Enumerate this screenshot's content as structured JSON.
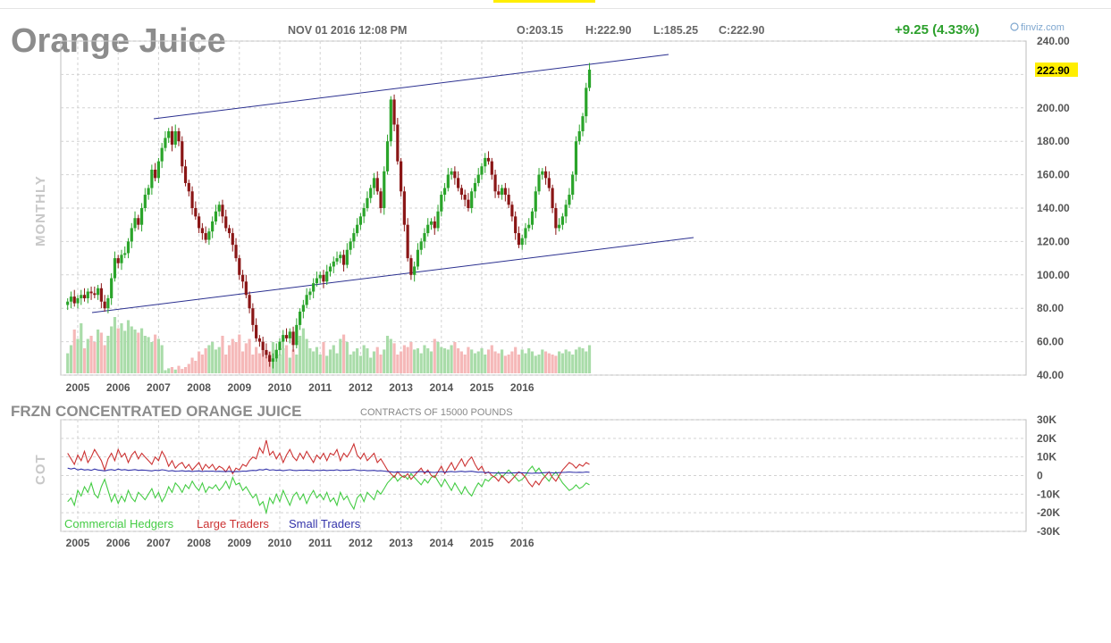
{
  "header": {
    "title": "Orange Juice",
    "datetime": "NOV 01 2016 12:08 PM",
    "open": "O:203.15",
    "high": "H:222.90",
    "low": "L:185.25",
    "close": "C:222.90",
    "change": "+9.25 (4.33%)",
    "brand": "finviz.com",
    "last_label": "222.90"
  },
  "colors": {
    "up": "#2aa42a",
    "down": "#8a1616",
    "vol_up": "#a9dca9",
    "vol_down": "#f5b8b8",
    "channel": "#2a2f8f",
    "commercial": "#44cc44",
    "large": "#cc3333",
    "small": "#3333aa",
    "highlight": "#ffee00"
  },
  "chart_data": [
    {
      "type": "candlestick",
      "title": "Orange Juice",
      "side_label": "MONTHLY",
      "xlabel": "",
      "ylabel": "",
      "ylim": [
        40,
        240
      ],
      "y_ticks": [
        "240.00",
        "200.00",
        "180.00",
        "160.00",
        "140.00",
        "120.00",
        "100.00",
        "80.00",
        "60.00",
        "40.00"
      ],
      "x_ticks": [
        "2005",
        "2006",
        "2007",
        "2008",
        "2009",
        "2010",
        "2011",
        "2012",
        "2013",
        "2014",
        "2015",
        "2016"
      ],
      "grid": true,
      "start_year": 2004.75,
      "closes": [
        84,
        87,
        83,
        86,
        88,
        86,
        90,
        89,
        88,
        92,
        84,
        80,
        86,
        98,
        110,
        107,
        112,
        113,
        120,
        128,
        134,
        130,
        140,
        148,
        152,
        163,
        158,
        168,
        176,
        182,
        186,
        178,
        186,
        180,
        165,
        155,
        150,
        140,
        135,
        128,
        125,
        121,
        126,
        132,
        138,
        142,
        135,
        128,
        125,
        118,
        110,
        100,
        96,
        88,
        80,
        70,
        62,
        60,
        55,
        52,
        48,
        50,
        55,
        60,
        64,
        62,
        66,
        58,
        70,
        78,
        82,
        88,
        90,
        95,
        98,
        100,
        96,
        102,
        105,
        108,
        110,
        112,
        106,
        115,
        120,
        125,
        130,
        135,
        140,
        146,
        152,
        158,
        150,
        140,
        162,
        180,
        205,
        190,
        168,
        150,
        130,
        110,
        100,
        105,
        115,
        120,
        125,
        130,
        132,
        128,
        138,
        148,
        152,
        160,
        162,
        158,
        152,
        148,
        145,
        140,
        150,
        155,
        160,
        165,
        170,
        168,
        160,
        150,
        148,
        152,
        148,
        142,
        135,
        125,
        118,
        122,
        128,
        130,
        138,
        150,
        160,
        162,
        158,
        152,
        140,
        128,
        130,
        135,
        142,
        148,
        160,
        180,
        186,
        195,
        212,
        222.9
      ],
      "volume_relative": [
        0.32,
        0.45,
        0.7,
        0.55,
        0.8,
        0.4,
        0.55,
        0.6,
        0.5,
        0.7,
        0.65,
        0.45,
        0.6,
        0.75,
        0.9,
        0.72,
        0.8,
        0.68,
        0.85,
        0.75,
        0.7,
        0.65,
        0.72,
        0.6,
        0.58,
        0.5,
        0.62,
        0.55,
        0.45,
        0.05,
        0.08,
        0.1,
        0.06,
        0.12,
        0.07,
        0.1,
        0.15,
        0.25,
        0.2,
        0.35,
        0.3,
        0.4,
        0.45,
        0.5,
        0.38,
        0.42,
        0.6,
        0.3,
        0.45,
        0.55,
        0.5,
        0.62,
        0.35,
        0.48,
        0.55,
        0.3,
        0.42,
        0.32,
        0.4,
        0.28,
        0.35,
        0.5,
        0.38,
        0.3,
        0.4,
        0.45,
        0.25,
        0.38,
        0.3,
        0.6,
        0.72,
        0.55,
        0.4,
        0.35,
        0.42,
        0.3,
        0.5,
        0.28,
        0.38,
        0.45,
        0.32,
        0.55,
        0.62,
        0.5,
        0.3,
        0.35,
        0.4,
        0.28,
        0.45,
        0.4,
        0.25,
        0.35,
        0.42,
        0.3,
        0.38,
        0.6,
        0.55,
        0.48,
        0.3,
        0.35,
        0.45,
        0.42,
        0.5,
        0.38,
        0.4,
        0.32,
        0.45,
        0.4,
        0.35,
        0.55,
        0.5,
        0.42,
        0.4,
        0.38,
        0.45,
        0.5,
        0.4,
        0.35,
        0.3,
        0.42,
        0.38,
        0.32,
        0.35,
        0.4,
        0.3,
        0.38,
        0.45,
        0.35,
        0.32,
        0.38,
        0.28,
        0.3,
        0.35,
        0.42,
        0.3,
        0.38,
        0.32,
        0.4,
        0.35,
        0.28,
        0.3,
        0.38,
        0.35,
        0.32,
        0.3,
        0.28,
        0.35,
        0.32,
        0.38,
        0.35,
        0.3,
        0.38,
        0.42,
        0.4,
        0.35,
        0.45
      ]
    },
    {
      "type": "line",
      "title": "FRZN CONCENTRATED ORANGE JUICE",
      "subtitle": "CONTRACTS OF 15000 POUNDS",
      "side_label": "COT",
      "xlabel": "",
      "ylabel": "",
      "ylim": [
        -30000,
        30000
      ],
      "y_ticks": [
        "30K",
        "20K",
        "10K",
        "0",
        "-10K",
        "-20K",
        "-30K"
      ],
      "x_ticks": [
        "2005",
        "2006",
        "2007",
        "2008",
        "2009",
        "2010",
        "2011",
        "2012",
        "2013",
        "2014",
        "2015",
        "2016"
      ],
      "grid": true,
      "legend_position": "bottom-left",
      "start_year": 2004.75,
      "series": [
        {
          "name": "Commercial Hedgers",
          "values": [
            -14000,
            -12000,
            -16000,
            -8000,
            -11000,
            -6000,
            -9000,
            -4000,
            -10000,
            -12000,
            -6000,
            -2000,
            -8000,
            -14000,
            -10000,
            -15000,
            -11000,
            -14000,
            -8000,
            -12000,
            -14000,
            -9000,
            -11000,
            -13000,
            -10000,
            -7000,
            -12000,
            -9000,
            -14000,
            -11000,
            -6000,
            -9000,
            -4000,
            -6000,
            -9000,
            -5000,
            -7000,
            -3000,
            -6000,
            -8000,
            -4000,
            -9000,
            -6000,
            -7000,
            -5000,
            -8000,
            -6000,
            -3000,
            -7000,
            -1000,
            -5000,
            -4000,
            -8000,
            -6000,
            -9000,
            -12000,
            -10000,
            -16000,
            -14000,
            -20000,
            -12000,
            -15000,
            -10000,
            -14000,
            -8000,
            -12000,
            -16000,
            -11000,
            -9000,
            -13000,
            -10000,
            -15000,
            -11000,
            -8000,
            -12000,
            -10000,
            -13000,
            -9000,
            -14000,
            -12000,
            -16000,
            -9000,
            -13000,
            -11000,
            -15000,
            -18000,
            -12000,
            -10000,
            -14000,
            -9000,
            -11000,
            -13000,
            -8000,
            -10000,
            -7000,
            -4000,
            -2000,
            0,
            -3000,
            -1000,
            0,
            -2000,
            1000,
            -1000,
            -3000,
            -5000,
            -2000,
            -4000,
            -1000,
            0,
            -3000,
            -6000,
            -2000,
            -5000,
            -8000,
            -4000,
            -7000,
            -10000,
            -6000,
            -9000,
            -11000,
            -7000,
            -4000,
            -6000,
            -2000,
            -3000,
            -1000,
            0,
            2000,
            -1000,
            1000,
            3000,
            1000,
            -1000,
            -3000,
            -2000,
            0,
            3000,
            5000,
            2000,
            4000,
            1000,
            -1000,
            -3000,
            0,
            2000,
            -1000,
            -4000,
            -6000,
            -8000,
            -7000,
            -5000,
            -7000,
            -6000,
            -4000,
            -5000
          ]
        },
        {
          "name": "Large Traders",
          "values": [
            12000,
            9000,
            6000,
            11000,
            8000,
            13000,
            7000,
            10000,
            14000,
            11000,
            8000,
            3000,
            9000,
            12000,
            8000,
            14000,
            10000,
            12000,
            7000,
            11000,
            13000,
            9000,
            12000,
            10000,
            8000,
            6000,
            10000,
            8000,
            13000,
            10000,
            5000,
            8000,
            4000,
            6000,
            7000,
            4000,
            6000,
            3000,
            5000,
            7000,
            3000,
            6000,
            4000,
            6000,
            3000,
            5000,
            4000,
            2000,
            5000,
            1000,
            4000,
            3000,
            6000,
            5000,
            8000,
            10000,
            9000,
            15000,
            12000,
            19000,
            11000,
            13000,
            9000,
            12000,
            7000,
            11000,
            14000,
            10000,
            8000,
            12000,
            9000,
            13000,
            10000,
            7000,
            11000,
            9000,
            12000,
            8000,
            12000,
            11000,
            14000,
            8000,
            12000,
            10000,
            13000,
            17000,
            11000,
            9000,
            12000,
            8000,
            10000,
            12000,
            7000,
            9000,
            6000,
            3000,
            1000,
            -1000,
            2000,
            0,
            -1000,
            1000,
            -2000,
            0,
            2000,
            4000,
            1000,
            3000,
            0,
            -1000,
            2000,
            5000,
            1000,
            4000,
            7000,
            3000,
            6000,
            9000,
            5000,
            8000,
            10000,
            6000,
            3000,
            5000,
            1000,
            2000,
            0,
            -1000,
            -3000,
            0,
            -2000,
            -4000,
            -2000,
            0,
            2000,
            1000,
            -1000,
            -4000,
            -6000,
            -3000,
            -5000,
            -2000,
            0,
            2000,
            -1000,
            -3000,
            0,
            3000,
            5000,
            7000,
            6000,
            4000,
            6000,
            5000,
            7000,
            6000
          ]
        },
        {
          "name": "Small Traders",
          "values": [
            4000,
            3500,
            4000,
            3000,
            3500,
            3000,
            3200,
            2800,
            3500,
            3000,
            2800,
            2500,
            3000,
            3200,
            2800,
            3500,
            3000,
            3200,
            2800,
            3000,
            3200,
            2800,
            3000,
            2900,
            2700,
            2500,
            2900,
            2700,
            3100,
            2900,
            2400,
            2700,
            2300,
            2400,
            2600,
            2300,
            2500,
            2200,
            2400,
            2500,
            2200,
            2400,
            2300,
            2400,
            2200,
            2300,
            2200,
            2100,
            2300,
            2000,
            2200,
            2100,
            2400,
            2300,
            2600,
            2800,
            2700,
            3200,
            3000,
            3500,
            2900,
            3100,
            2800,
            3000,
            2600,
            2900,
            3100,
            2800,
            2700,
            2900,
            2800,
            3000,
            2800,
            2600,
            2900,
            2700,
            3000,
            2700,
            2900,
            2800,
            3100,
            2700,
            2900,
            2800,
            3000,
            3200,
            2900,
            2700,
            2900,
            2600,
            2700,
            2800,
            2500,
            2600,
            2400,
            2200,
            2000,
            1800,
            2000,
            1900,
            1800,
            1900,
            1700,
            1800,
            2000,
            2100,
            1900,
            2000,
            1800,
            1700,
            1900,
            2100,
            1800,
            2000,
            2200,
            1900,
            2100,
            2300,
            2000,
            2200,
            2300,
            2000,
            1800,
            1900,
            1600,
            1700,
            1500,
            1400,
            1300,
            1500,
            1400,
            1300,
            1400,
            1500,
            1600,
            1500,
            1400,
            1300,
            1200,
            1400,
            1300,
            1500,
            1600,
            1700,
            1500,
            1400,
            1600,
            1700,
            1800,
            1900,
            1800,
            1700,
            1800,
            1700,
            1900,
            1800
          ]
        }
      ]
    }
  ]
}
